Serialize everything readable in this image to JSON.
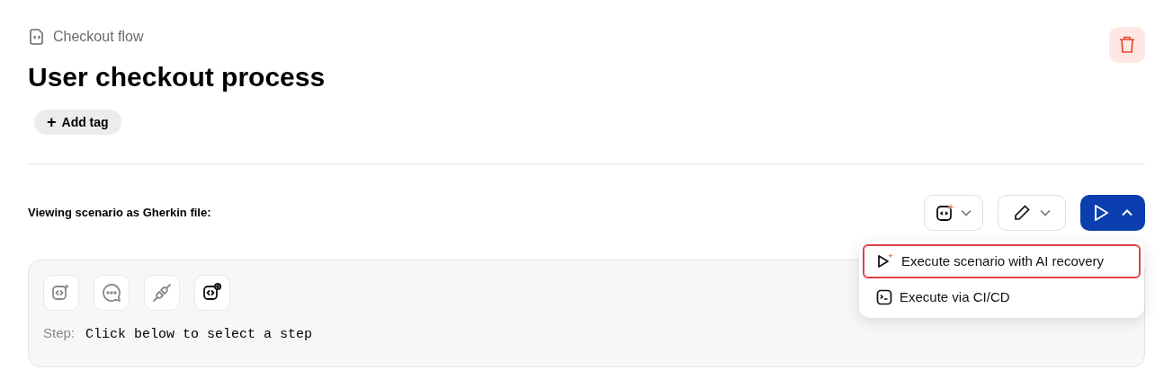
{
  "breadcrumb": "Checkout flow",
  "title": "User checkout process",
  "add_tag": {
    "icon": "+",
    "label": "Add tag"
  },
  "view_label": "Viewing scenario as Gherkin file:",
  "step_tools": [
    {
      "kind": "ai-code",
      "active": false
    },
    {
      "kind": "comment",
      "active": false
    },
    {
      "kind": "plug",
      "active": false
    },
    {
      "kind": "code-view",
      "active": true
    }
  ],
  "step": {
    "label": "Step:",
    "value": "Click below to select a step"
  },
  "run_menu": {
    "expanded": true,
    "items": [
      {
        "kind": "ai",
        "label": "Execute scenario with AI recovery",
        "selected": true
      },
      {
        "kind": "terminal",
        "label": "Execute via CI/CD",
        "selected": false
      }
    ]
  }
}
